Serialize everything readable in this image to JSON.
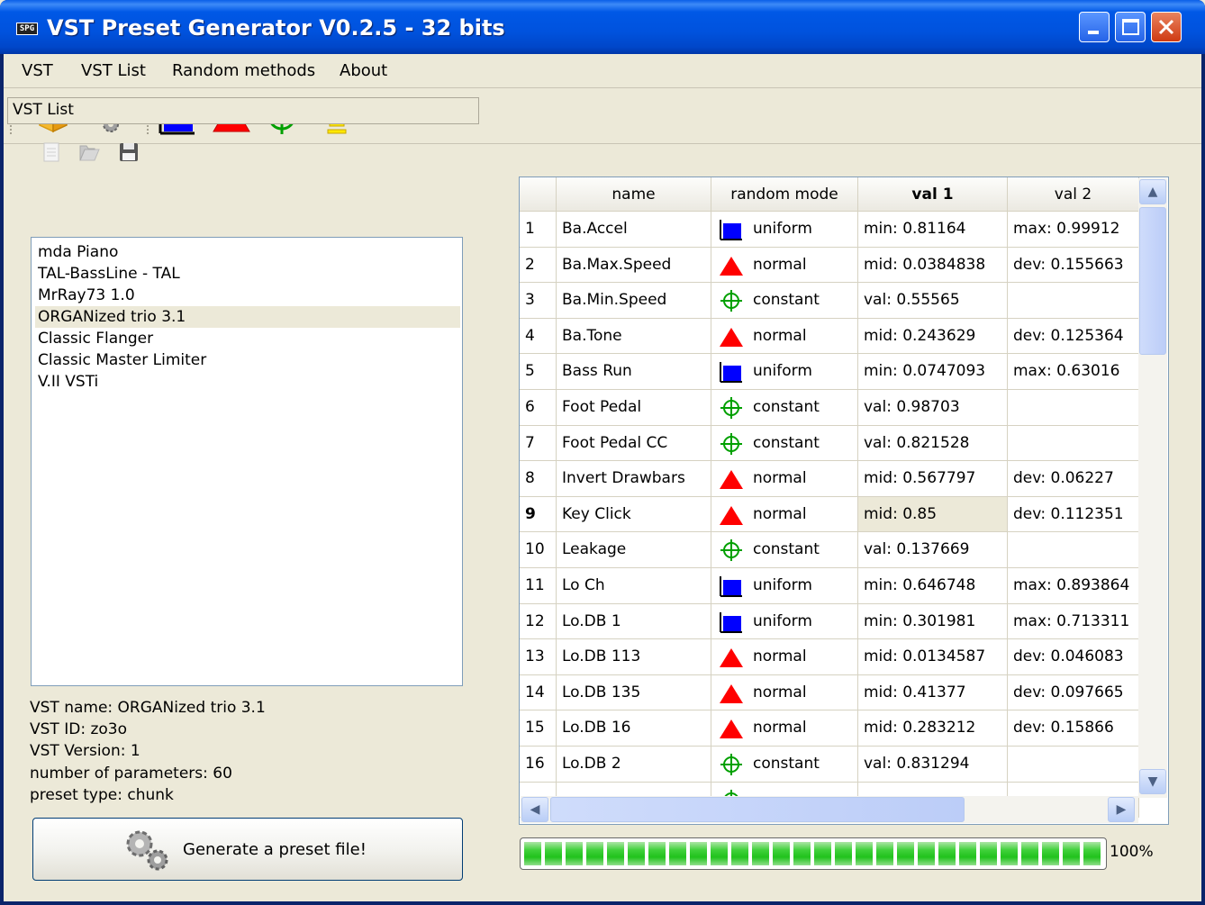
{
  "window": {
    "title": "VST Preset Generator V0.2.5 - 32 bits",
    "app_icon_text": "SPG"
  },
  "menu": [
    {
      "label": "VST"
    },
    {
      "label": "VST List"
    },
    {
      "label": "Random methods"
    },
    {
      "label": "About"
    }
  ],
  "toolbar": {
    "tools": [
      "open-box-icon",
      "gears-icon",
      "uniform-icon",
      "normal-icon",
      "constant-icon",
      "yellow-bar-icon"
    ]
  },
  "vst_list": {
    "title": "VST List",
    "items": [
      "mda Piano",
      "TAL-BassLine - TAL",
      "MrRay73 1.0",
      "ORGANized trio 3.1",
      "Classic Flanger",
      "Classic Master Limiter",
      "V.II VSTi"
    ],
    "selected_index": 3
  },
  "info": {
    "name": "VST name: ORGANized trio 3.1",
    "id": "VST ID: zo3o",
    "version": "VST Version: 1",
    "params": "number of parameters: 60",
    "preset_type": "preset type: chunk"
  },
  "generate_button": {
    "label": "Generate a preset file!"
  },
  "table": {
    "headers": [
      "name",
      "random mode",
      "val 1",
      "val 2"
    ],
    "rows": [
      {
        "n": "1",
        "name": "Ba.Accel",
        "mode": "uniform",
        "v1": "min: 0.81164",
        "v2": "max: 0.99912"
      },
      {
        "n": "2",
        "name": "Ba.Max.Speed",
        "mode": "normal",
        "v1": "mid: 0.0384838",
        "v2": "dev: 0.155663"
      },
      {
        "n": "3",
        "name": "Ba.Min.Speed",
        "mode": "constant",
        "v1": "val: 0.55565",
        "v2": ""
      },
      {
        "n": "4",
        "name": "Ba.Tone",
        "mode": "normal",
        "v1": "mid: 0.243629",
        "v2": "dev: 0.125364"
      },
      {
        "n": "5",
        "name": "Bass Run",
        "mode": "uniform",
        "v1": "min: 0.0747093",
        "v2": "max: 0.63016"
      },
      {
        "n": "6",
        "name": "Foot Pedal",
        "mode": "constant",
        "v1": "val: 0.98703",
        "v2": ""
      },
      {
        "n": "7",
        "name": "Foot Pedal CC",
        "mode": "constant",
        "v1": "val: 0.821528",
        "v2": ""
      },
      {
        "n": "8",
        "name": "Invert Drawbars",
        "mode": "normal",
        "v1": "mid: 0.567797",
        "v2": "dev: 0.06227"
      },
      {
        "n": "9",
        "name": "Key Click",
        "mode": "normal",
        "v1": "mid: 0.85",
        "v2": "dev: 0.112351"
      },
      {
        "n": "10",
        "name": "Leakage",
        "mode": "constant",
        "v1": "val: 0.137669",
        "v2": ""
      },
      {
        "n": "11",
        "name": "Lo Ch",
        "mode": "uniform",
        "v1": "min: 0.646748",
        "v2": "max: 0.893864"
      },
      {
        "n": "12",
        "name": "Lo.DB 1",
        "mode": "uniform",
        "v1": "min: 0.301981",
        "v2": "max: 0.713311"
      },
      {
        "n": "13",
        "name": "Lo.DB 113",
        "mode": "normal",
        "v1": "mid: 0.0134587",
        "v2": "dev: 0.046083"
      },
      {
        "n": "14",
        "name": "Lo.DB 135",
        "mode": "normal",
        "v1": "mid: 0.41377",
        "v2": "dev: 0.097665"
      },
      {
        "n": "15",
        "name": "Lo.DB 16",
        "mode": "normal",
        "v1": "mid: 0.283212",
        "v2": "dev: 0.15866"
      },
      {
        "n": "16",
        "name": "Lo.DB 2",
        "mode": "constant",
        "v1": "val: 0.831294",
        "v2": ""
      }
    ],
    "current_row": 8
  },
  "progress": {
    "value": 1.0,
    "label": "100%"
  },
  "colors": {
    "uniform": "#0000ff",
    "normal": "#ff0000",
    "constant": "#00a000",
    "progress": "#22c41e"
  }
}
